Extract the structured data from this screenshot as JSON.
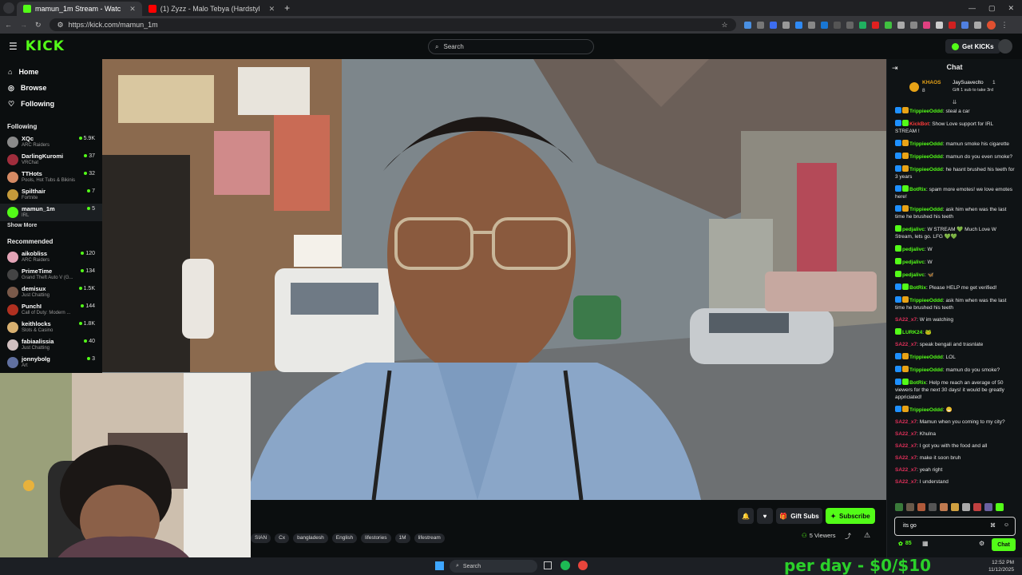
{
  "browser": {
    "tabs": [
      {
        "title": "mamun_1m Stream - Watc",
        "active": true,
        "favicon_color": "#53fc18"
      },
      {
        "title": "(1) Zyzz - Malo Tebya (Hardstyl",
        "active": false,
        "favicon_color": "#ff0000"
      }
    ],
    "url": "https://kick.com/mamun_1m"
  },
  "header": {
    "logo": "KICK",
    "search_placeholder": "Search",
    "get_kicks": "Get KICKs"
  },
  "nav": [
    {
      "label": "Home",
      "icon": "home-icon"
    },
    {
      "label": "Browse",
      "icon": "compass-icon"
    },
    {
      "label": "Following",
      "icon": "heart-icon"
    }
  ],
  "following": {
    "title": "Following",
    "channels": [
      {
        "name": "XQc",
        "game": "ARC Raiders",
        "viewers": "5.9K",
        "color": "#8a8a8a"
      },
      {
        "name": "DarlingKuromi",
        "game": "VRChat",
        "viewers": "37",
        "color": "#a02d3c"
      },
      {
        "name": "TTHots",
        "game": "Pools, Hot Tubs & Bikinis",
        "viewers": "32",
        "color": "#d58a64"
      },
      {
        "name": "Spilthair",
        "game": "Fortnite",
        "viewers": "7",
        "color": "#c49a3a"
      },
      {
        "name": "mamun_1m",
        "game": "IRL",
        "viewers": "5",
        "color": "#53fc18",
        "selected": true
      }
    ],
    "show_more": "Show More"
  },
  "recommended": {
    "title": "Recommended",
    "channels": [
      {
        "name": "aikobliss",
        "game": "ARC Raiders",
        "viewers": "120",
        "color": "#e3a4b6"
      },
      {
        "name": "PrimeTime",
        "game": "Grand Theft Auto V (G...",
        "viewers": "134",
        "color": "#444"
      },
      {
        "name": "demisux",
        "game": "Just Chatting",
        "viewers": "1.5K",
        "color": "#7a5a4a"
      },
      {
        "name": "PunchI",
        "game": "Call of Duty: Modern ...",
        "viewers": "144",
        "color": "#b03020"
      },
      {
        "name": "keithlocks",
        "game": "Slots & Casino",
        "viewers": "1.8K",
        "color": "#d8b070"
      },
      {
        "name": "fabiaalissia",
        "game": "Just Chatting",
        "viewers": "40",
        "color": "#d0c0c0"
      },
      {
        "name": "jonnybolg",
        "game": "Art",
        "viewers": "3",
        "color": "#6070a0"
      }
    ]
  },
  "stream": {
    "tags": [
      "SIAN",
      "Cx",
      "bangladesh",
      "English",
      "lifestories",
      "1M",
      "lifestream"
    ],
    "gift_subs": "Gift Subs",
    "subscribe": "Subscribe",
    "viewers": "5 Viewers"
  },
  "chat": {
    "title": "Chat",
    "pinned": {
      "left_name": "KHAOS",
      "left_count": "8",
      "right_name": "JaySuaveclto",
      "right_count": "1",
      "right_sub": "Gift 1 sub to take 3rd"
    },
    "messages": [
      {
        "user": "TrippieeOddd",
        "color": "#53fc18",
        "text": "steal a car",
        "badges": [
          "#1e90ff",
          "#e8a317"
        ]
      },
      {
        "user": "KickBot",
        "color": "#ff3b3b",
        "text": "Show Love support for IRL STREAM !",
        "badges": [
          "#1e90ff",
          "#53fc18"
        ]
      },
      {
        "user": "TrippieeOddd",
        "color": "#53fc18",
        "text": "mamun smoke his cigarette",
        "badges": [
          "#1e90ff",
          "#e8a317"
        ]
      },
      {
        "user": "TrippieeOddd",
        "color": "#53fc18",
        "text": "mamun do you even smoke?",
        "badges": [
          "#1e90ff",
          "#e8a317"
        ]
      },
      {
        "user": "TrippieeOddd",
        "color": "#53fc18",
        "text": "he hasnt brushed his teeth for 3 years",
        "badges": [
          "#1e90ff",
          "#e8a317"
        ]
      },
      {
        "user": "BotRix",
        "color": "#53fc18",
        "text": "spam more emotes! we love emotes here!",
        "badges": [
          "#1e90ff",
          "#53fc18"
        ]
      },
      {
        "user": "TrippieeOddd",
        "color": "#53fc18",
        "text": "ask him when was the last time he brushed his teeth",
        "badges": [
          "#1e90ff",
          "#e8a317"
        ]
      },
      {
        "user": "pedjalivc",
        "color": "#53fc18",
        "text": "W STREAM 💚 Much Love W Stream, lets go. LFG 💚💚",
        "badges": [
          "#53fc18"
        ]
      },
      {
        "user": "pedjalivc",
        "color": "#53fc18",
        "text": "W",
        "badges": [
          "#53fc18"
        ]
      },
      {
        "user": "pedjalivc",
        "color": "#53fc18",
        "text": "W",
        "badges": [
          "#53fc18"
        ]
      },
      {
        "user": "pedjalivc",
        "color": "#53fc18",
        "text": "🦋",
        "badges": [
          "#53fc18"
        ]
      },
      {
        "user": "BotRix",
        "color": "#53fc18",
        "text": "Please HELP me get verified!",
        "badges": [
          "#1e90ff",
          "#53fc18"
        ]
      },
      {
        "user": "TrippieeOddd",
        "color": "#53fc18",
        "text": "ask him when was the last time he brushed his teeth",
        "badges": [
          "#1e90ff",
          "#e8a317"
        ]
      },
      {
        "user": "SA22_x7",
        "color": "#e0305a",
        "text": "W im watching",
        "badges": []
      },
      {
        "user": "LURK24",
        "color": "#53fc18",
        "text": "🐸",
        "badges": [
          "#53fc18"
        ]
      },
      {
        "user": "SA22_x7",
        "color": "#e0305a",
        "text": "speak bengali and trasnlate",
        "badges": []
      },
      {
        "user": "TrippieeOddd",
        "color": "#53fc18",
        "text": "LOL",
        "badges": [
          "#1e90ff",
          "#e8a317"
        ]
      },
      {
        "user": "TrippieeOddd",
        "color": "#53fc18",
        "text": "mamun do you smoke?",
        "badges": [
          "#1e90ff",
          "#e8a317"
        ]
      },
      {
        "user": "BotRix",
        "color": "#53fc18",
        "text": "Help me reach an average of 50 viewers for the next 30 days! it would be greatly appriciated!",
        "badges": [
          "#1e90ff",
          "#53fc18"
        ]
      },
      {
        "user": "TrippieeOddd",
        "color": "#53fc18",
        "text": "😁",
        "badges": [
          "#1e90ff",
          "#e8a317"
        ]
      },
      {
        "user": "SA22_x7",
        "color": "#e0305a",
        "text": "Mamun when you coming to my city?",
        "badges": []
      },
      {
        "user": "SA22_x7",
        "color": "#e0305a",
        "text": "Khulna",
        "badges": []
      },
      {
        "user": "SA22_x7",
        "color": "#e0305a",
        "text": "I got you with the food and all",
        "badges": []
      },
      {
        "user": "SA22_x7",
        "color": "#e0305a",
        "text": "make it soon bruh",
        "badges": []
      },
      {
        "user": "SA22_x7",
        "color": "#e0305a",
        "text": "yeah right",
        "badges": []
      },
      {
        "user": "SA22_x7",
        "color": "#e0305a",
        "text": "I understand",
        "badges": []
      }
    ],
    "input_value": "its go",
    "points": "85",
    "send": "Chat"
  },
  "taskbar": {
    "search": "Search",
    "time": "12:52 PM",
    "date": "11/12/2025"
  },
  "overlay": {
    "text": "per day - $0/$10"
  }
}
